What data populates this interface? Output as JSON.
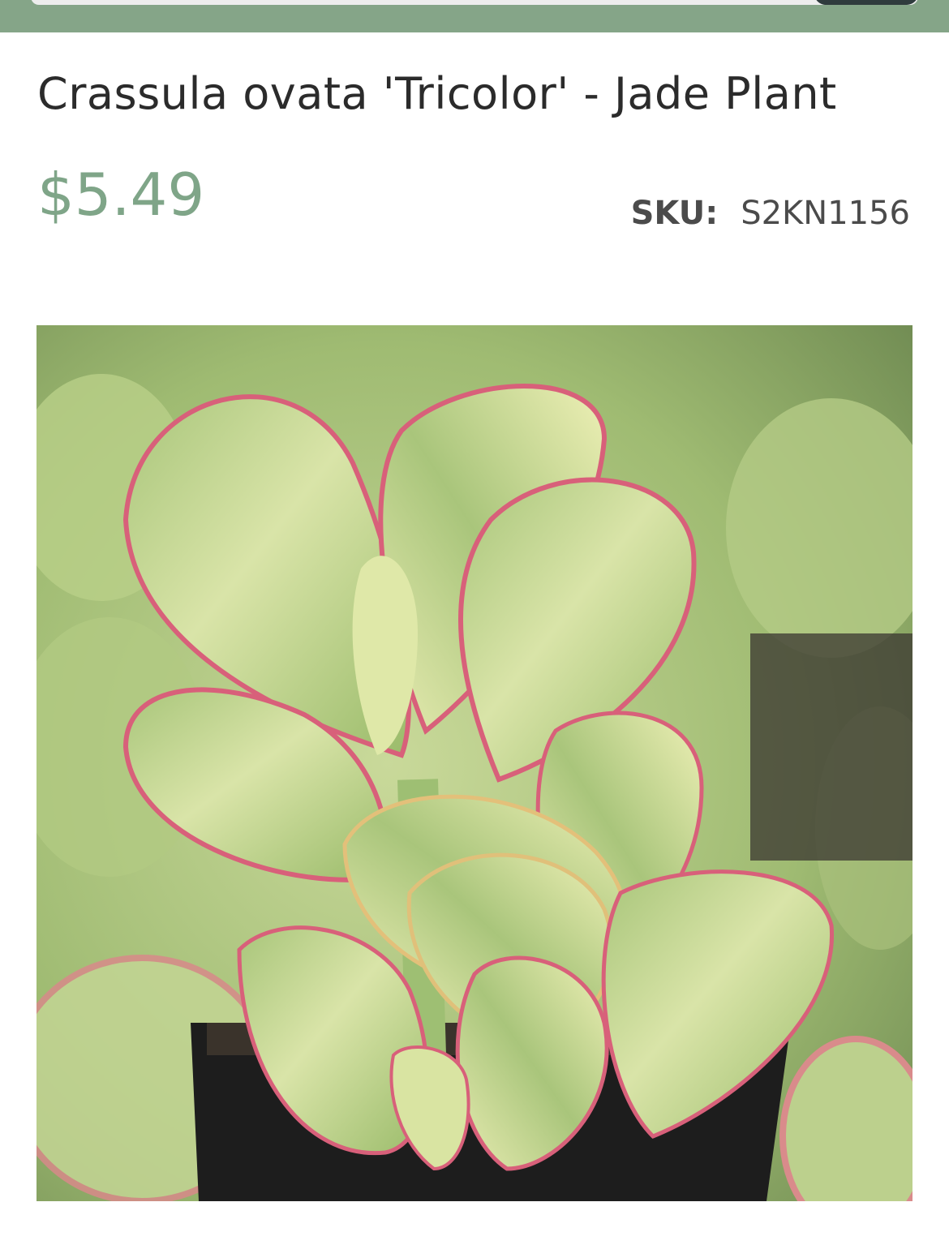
{
  "product": {
    "title": "Crassula ovata 'Tricolor' - Jade Plant",
    "price": "$5.49",
    "sku_label": "SKU:",
    "sku_value": "S2KN1156"
  },
  "colors": {
    "header_bar": "#85a588",
    "price": "#7fa588",
    "title": "#2b2b2b"
  }
}
